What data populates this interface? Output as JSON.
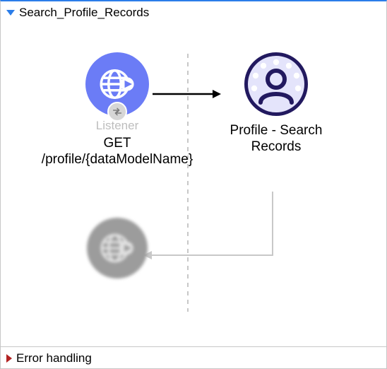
{
  "flow": {
    "title": "Search_Profile_Records",
    "expanded": true,
    "nodes": {
      "listener": {
        "sublabel": "Listener",
        "label": "GET /profile/{dataModelName}"
      },
      "profile": {
        "label": "Profile - Search Records"
      },
      "response": {}
    }
  },
  "error_panel": {
    "title": "Error handling",
    "expanded": false
  }
}
